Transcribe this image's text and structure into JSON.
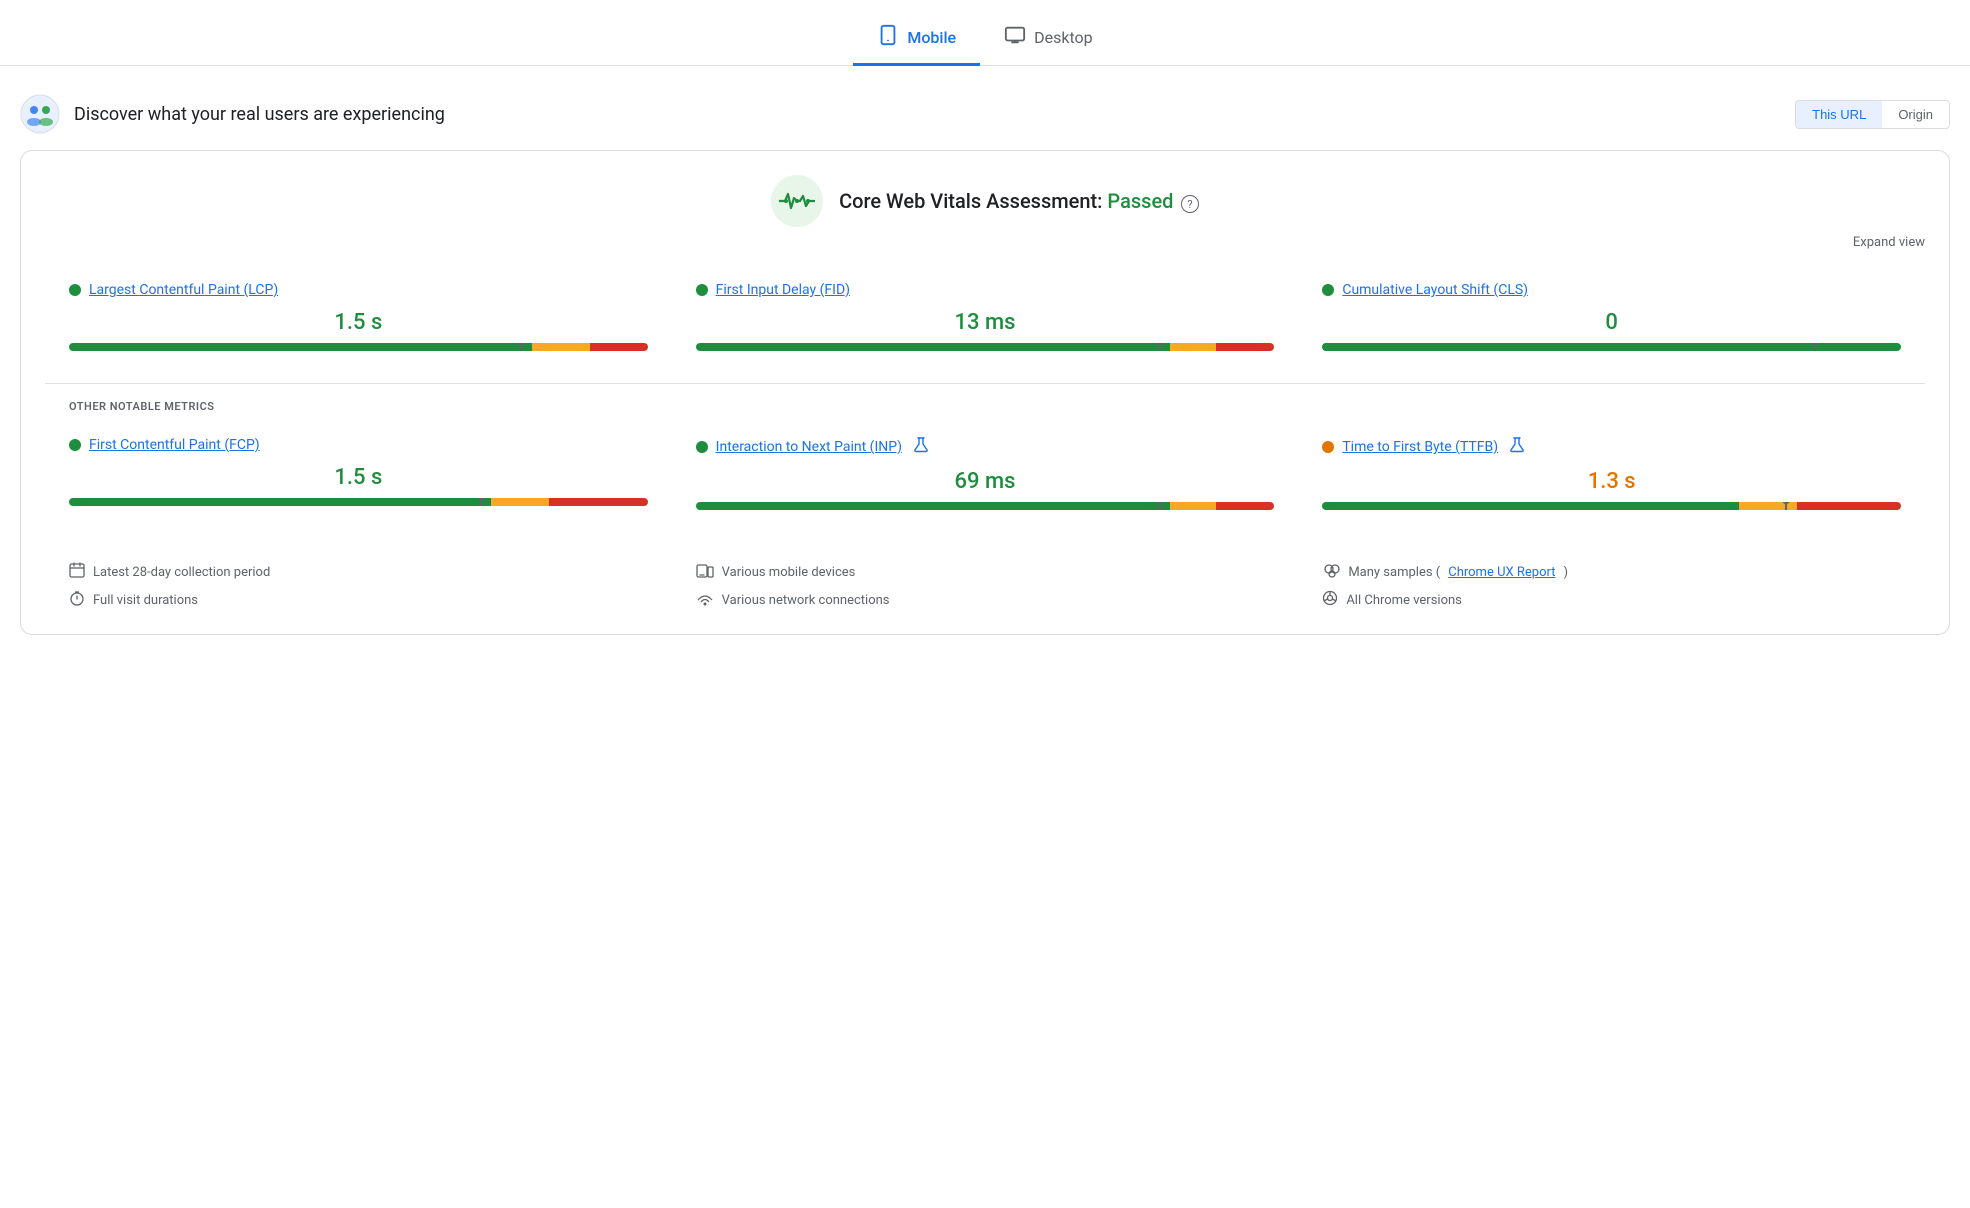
{
  "tabs": [
    {
      "id": "mobile",
      "label": "Mobile",
      "active": true,
      "icon": "📱"
    },
    {
      "id": "desktop",
      "label": "Desktop",
      "active": false,
      "icon": "🖥"
    }
  ],
  "header": {
    "title": "Discover what your real users are experiencing",
    "url_button": "This URL",
    "origin_button": "Origin"
  },
  "cwv": {
    "assessment_prefix": "Core Web Vitals Assessment: ",
    "assessment_status": "Passed",
    "help_tooltip": "?",
    "expand_label": "Expand view"
  },
  "metrics": [
    {
      "id": "lcp",
      "dot_color": "green",
      "name": "Largest Contentful Paint (LCP)",
      "value": "1.5 s",
      "value_color": "green",
      "bar": {
        "green": 80,
        "orange": 10,
        "red": 10,
        "marker": 78
      }
    },
    {
      "id": "fid",
      "dot_color": "green",
      "name": "First Input Delay (FID)",
      "value": "13 ms",
      "value_color": "green",
      "bar": {
        "green": 82,
        "orange": 8,
        "red": 10,
        "marker": 80
      }
    },
    {
      "id": "cls",
      "dot_color": "green",
      "name": "Cumulative Layout Shift (CLS)",
      "value": "0",
      "value_color": "green",
      "bar": {
        "green": 100,
        "orange": 0,
        "red": 0,
        "marker": 85
      }
    }
  ],
  "other_metrics_label": "OTHER NOTABLE METRICS",
  "other_metrics": [
    {
      "id": "fcp",
      "dot_color": "green",
      "name": "First Contentful Paint (FCP)",
      "value": "1.5 s",
      "value_color": "green",
      "has_lab": false,
      "bar": {
        "green": 73,
        "orange": 10,
        "red": 17,
        "marker": 71
      }
    },
    {
      "id": "inp",
      "dot_color": "green",
      "name": "Interaction to Next Paint (INP)",
      "value": "69 ms",
      "value_color": "green",
      "has_lab": true,
      "bar": {
        "green": 82,
        "orange": 8,
        "red": 10,
        "marker": 80
      }
    },
    {
      "id": "ttfb",
      "dot_color": "orange",
      "name": "Time to First Byte (TTFB)",
      "value": "1.3 s",
      "value_color": "orange",
      "has_lab": true,
      "bar": {
        "green": 72,
        "orange": 10,
        "red": 18,
        "marker": 80
      }
    }
  ],
  "footer": {
    "col1": [
      {
        "icon": "📅",
        "text": "Latest 28-day collection period"
      },
      {
        "icon": "⏱",
        "text": "Full visit durations"
      }
    ],
    "col2": [
      {
        "icon": "📱",
        "text": "Various mobile devices"
      },
      {
        "icon": "📶",
        "text": "Various network connections"
      }
    ],
    "col3": [
      {
        "icon": "👥",
        "text_prefix": "Many samples (",
        "link": "Chrome UX Report",
        "text_suffix": ")"
      },
      {
        "icon": "⊙",
        "text": "All Chrome versions"
      }
    ]
  }
}
